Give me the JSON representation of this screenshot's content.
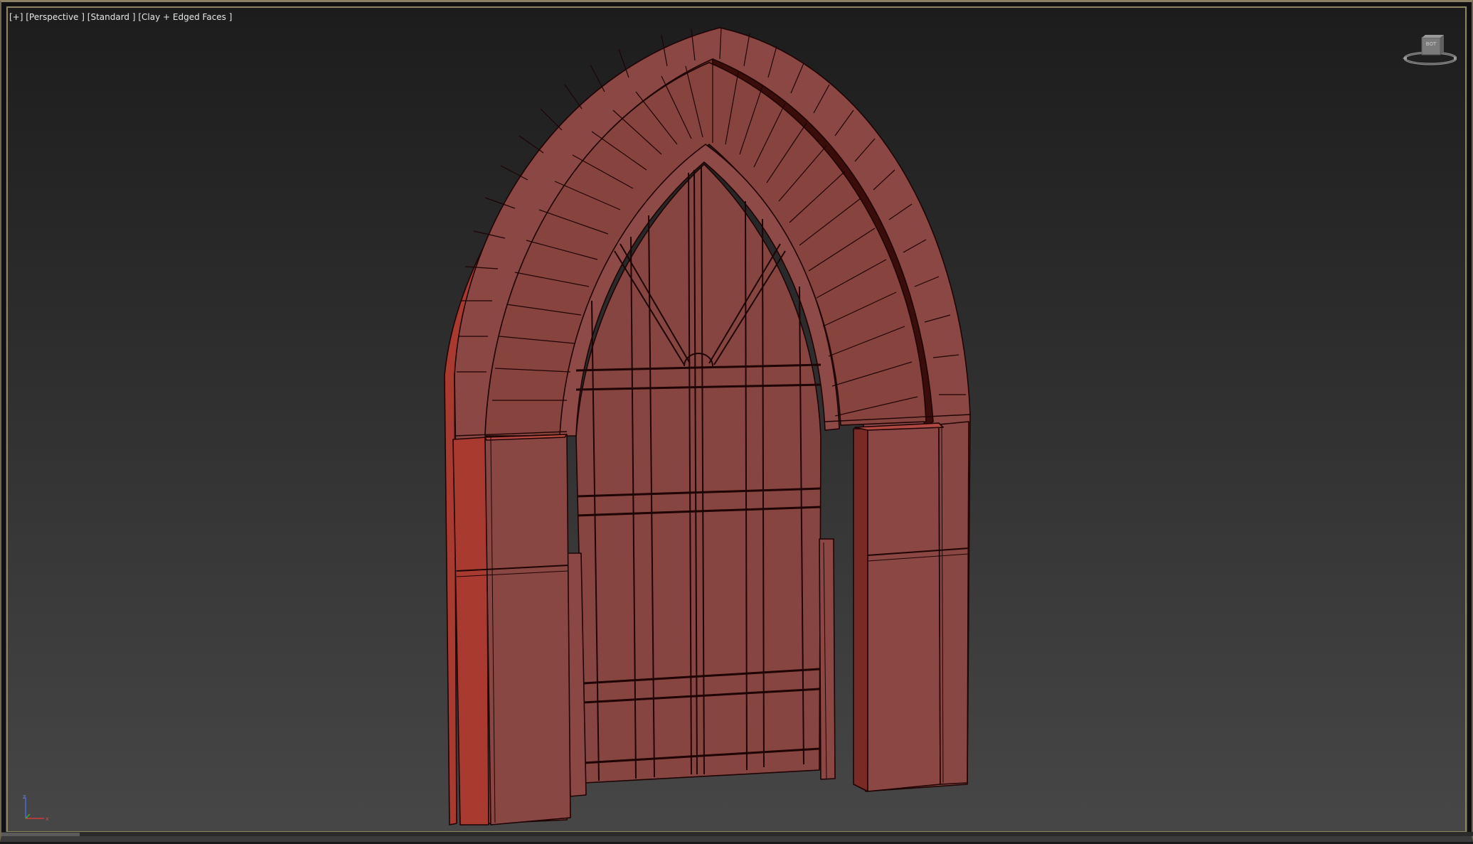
{
  "viewport": {
    "label_parts": [
      "[+]",
      "[Perspective ]",
      "[Standard ]",
      "[Clay + Edged Faces ]"
    ],
    "viewcube_face": "BOT",
    "axis": {
      "x": "x",
      "y": "y",
      "z": "z"
    }
  },
  "colors": {
    "viewport_top": "#1c1c1c",
    "viewport_bottom": "#474747",
    "active_frame": "#8d8460",
    "clay_face": "#894744",
    "clay_side": "#a83a30",
    "clay_dark": "#3b0d0a",
    "edge": "#1e0404"
  },
  "scene": {
    "object": "gothic-arch-doorway",
    "icons": [
      "viewcube-icon",
      "axis-tripod-icon"
    ]
  }
}
